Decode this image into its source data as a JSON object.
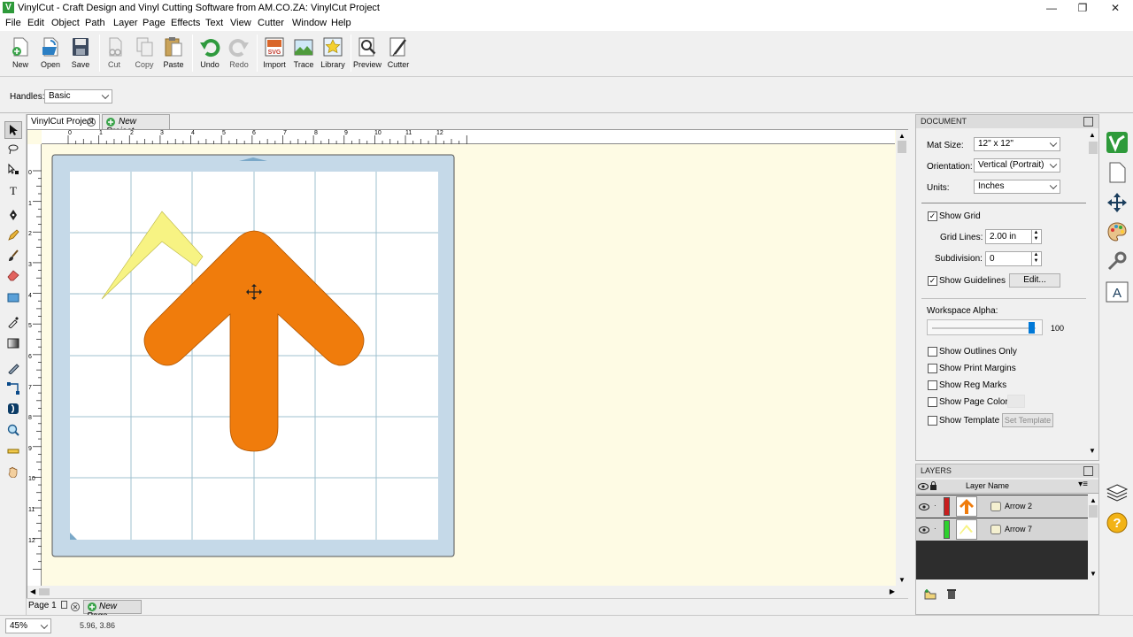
{
  "window": {
    "title": "VinylCut - Craft Design and Vinyl Cutting Software from AM.CO.ZA: VinylCut Project",
    "minimize_glyph": "—",
    "restore_glyph": "❐",
    "close_glyph": "✕"
  },
  "menu": [
    "File",
    "Edit",
    "Object",
    "Path",
    "Layer",
    "Page",
    "Effects",
    "Text",
    "View",
    "Cutter",
    "Window",
    "Help"
  ],
  "toolbar": {
    "new": "New",
    "open": "Open",
    "save": "Save",
    "cut": "Cut",
    "copy": "Copy",
    "paste": "Paste",
    "undo": "Undo",
    "redo": "Redo",
    "import": "Import",
    "trace": "Trace",
    "library": "Library",
    "preview": "Preview",
    "cutter": "Cutter"
  },
  "options": {
    "handles_label": "Handles:",
    "handles_value": "Basic"
  },
  "tabs": {
    "active": "VinylCut Project",
    "new": "New Project..."
  },
  "ruler": {
    "h": [
      "0",
      "1",
      "2",
      "3",
      "4",
      "5",
      "6",
      "7",
      "8",
      "9",
      "10",
      "11",
      "12"
    ],
    "v": [
      "0",
      "1",
      "2",
      "3",
      "4",
      "5",
      "6",
      "7",
      "8",
      "9",
      "10",
      "11",
      "12"
    ]
  },
  "pages": {
    "active": "Page 1",
    "new": "New Page..."
  },
  "status": {
    "zoom": "45%",
    "coords": "5.96, 3.86"
  },
  "document_panel": {
    "header": "DOCUMENT",
    "mat_size_label": "Mat Size:",
    "mat_size_value": "12\" x 12\"",
    "orientation_label": "Orientation:",
    "orientation_value": "Vertical (Portrait)",
    "units_label": "Units:",
    "units_value": "Inches",
    "show_grid": "Show Grid",
    "show_grid_checked": true,
    "grid_lines_label": "Grid Lines:",
    "grid_lines_value": "2.00 in",
    "subdivision_label": "Subdivision:",
    "subdivision_value": "0",
    "show_guidelines": "Show Guidelines",
    "show_guidelines_checked": true,
    "edit_button": "Edit...",
    "workspace_alpha_label": "Workspace Alpha:",
    "workspace_alpha_value": "100",
    "workspace_alpha_fraction": 1.0,
    "show_outlines_only": "Show Outlines Only",
    "show_print_margins": "Show Print Margins",
    "show_reg_marks": "Show Reg Marks",
    "show_page_color": "Show Page Color",
    "show_template": "Show Template",
    "set_template": "Set Template",
    "check_glyph": "✓"
  },
  "layers_panel": {
    "header": "LAYERS",
    "column": "Layer Name",
    "layers": [
      {
        "name": "Arrow 2",
        "color": "#c81e1e"
      },
      {
        "name": "Arrow 7",
        "color": "#2ed12e"
      }
    ]
  },
  "colors": {
    "accent_blue": "#0078d7",
    "mat_blue": "#c5d9e8",
    "workspace_bg": "#fefbe4",
    "orange_arrow": "#f07c0c",
    "yellow_chevron": "#f7f383"
  }
}
